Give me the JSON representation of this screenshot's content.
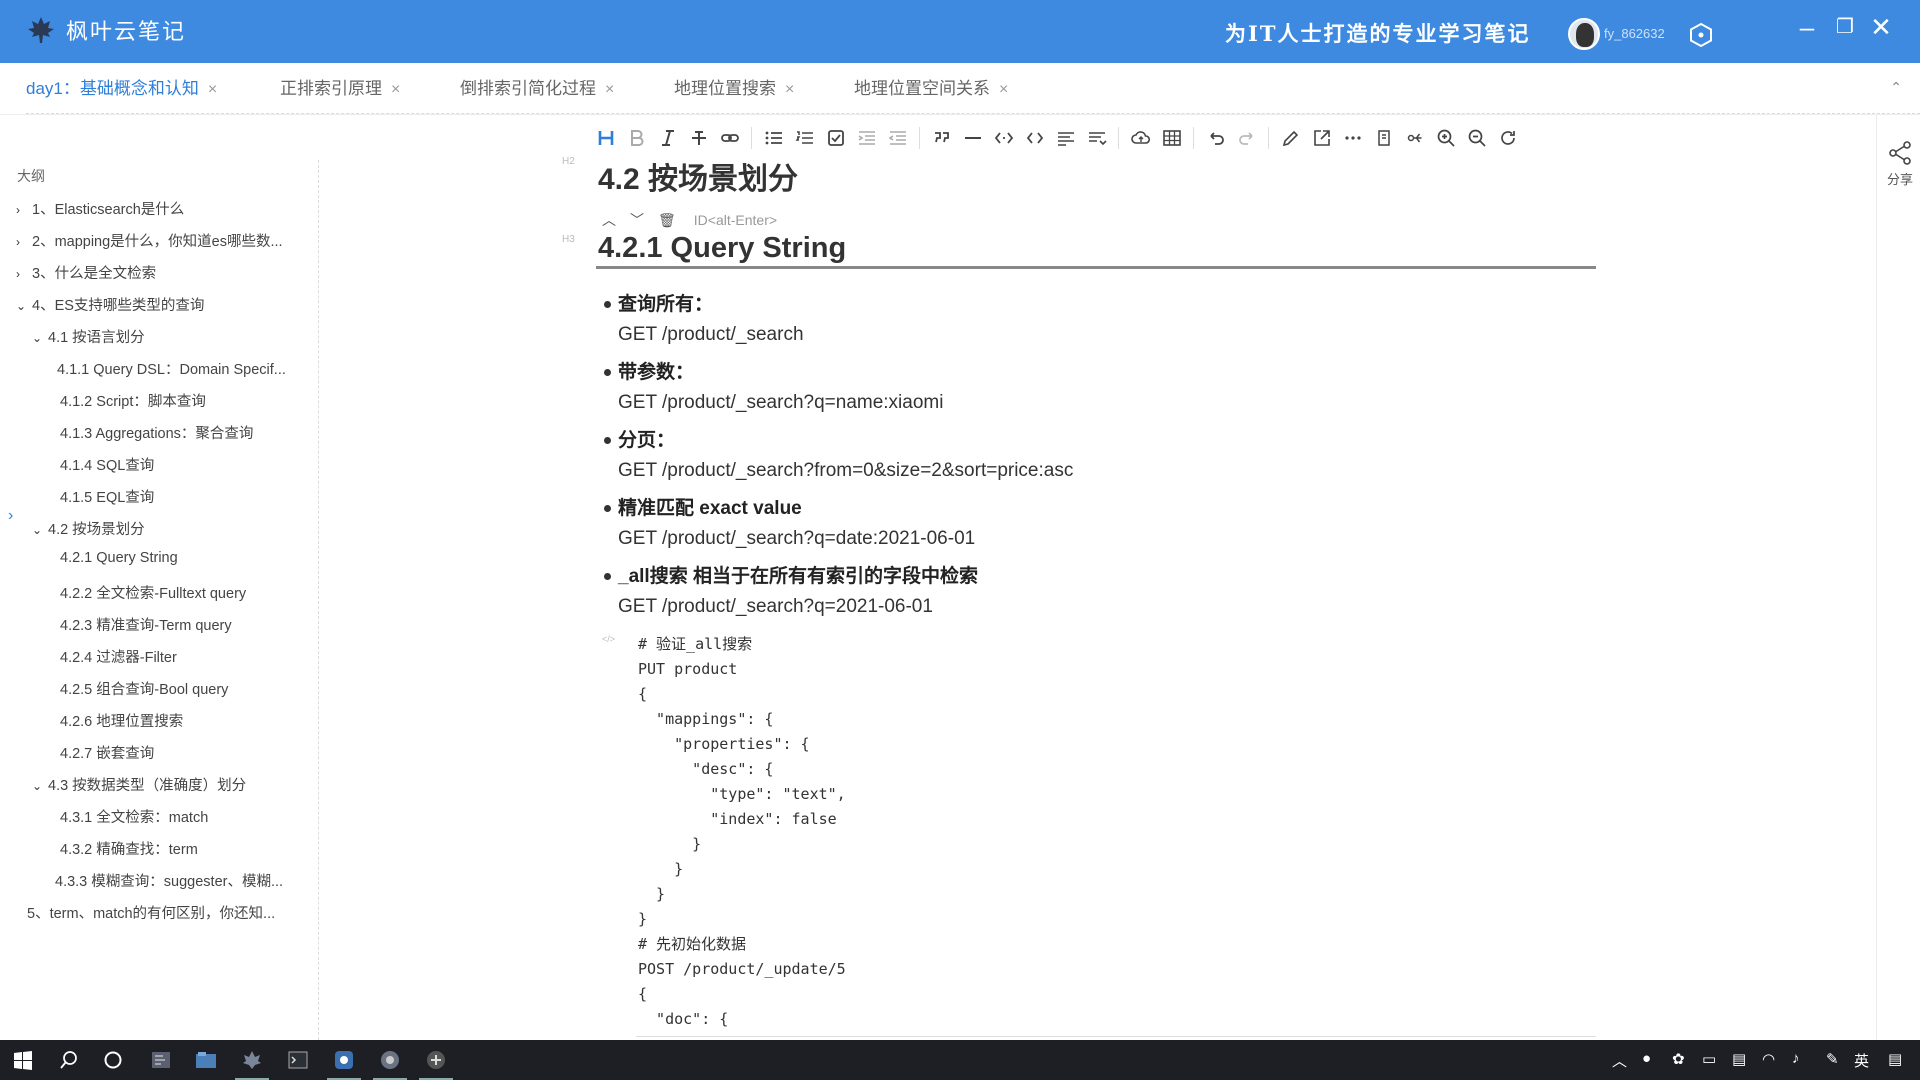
{
  "app": {
    "logo_text": "枫叶云笔记",
    "slogan": "为IT人士打造的专业学习笔记",
    "username": "fy_862632"
  },
  "tabs": [
    {
      "label": "day1：基础概念和认知",
      "active": true
    },
    {
      "label": "正排索引原理",
      "active": false
    },
    {
      "label": "倒排索引简化过程",
      "active": false
    },
    {
      "label": "地理位置搜索",
      "active": false
    },
    {
      "label": "地理位置空间关系",
      "active": false
    }
  ],
  "tab_close": "×",
  "toolbar_icons": [
    "heading-icon",
    "bold-icon",
    "italic-icon",
    "strikethrough-icon",
    "link-icon",
    "bullet-list-icon",
    "ordered-list-icon",
    "checkbox-icon",
    "indent-icon",
    "outdent-icon",
    "quote-icon",
    "hr-icon",
    "code-inline-icon",
    "code-block-icon",
    "align-icon",
    "wrap-icon",
    "cloud-icon",
    "table-icon",
    "undo-icon",
    "redo-icon",
    "edit-icon",
    "export-icon",
    "more-icon",
    "preview-icon",
    "mindmap-icon",
    "zoom-in-icon",
    "zoom-out-icon",
    "refresh-icon"
  ],
  "outline": {
    "title": "大纲",
    "items": [
      {
        "label": "1、Elasticsearch是什么",
        "arrow": "›",
        "level": 0
      },
      {
        "label": "2、mapping是什么，你知道es哪些数...",
        "arrow": "›",
        "level": 0
      },
      {
        "label": "3、什么是全文检索",
        "arrow": "›",
        "level": 0
      },
      {
        "label": "4、ES支持哪些类型的查询",
        "arrow": "⌄",
        "level": 0
      },
      {
        "label": "4.1 按语言划分",
        "arrow": "⌄",
        "level": 1
      },
      {
        "label": "4.1.1 Query DSL：Domain Specif...",
        "arrow": "",
        "level": 2
      },
      {
        "label": "4.1.2 Script：脚本查询",
        "arrow": "",
        "level": 2
      },
      {
        "label": "4.1.3 Aggregations：聚合查询",
        "arrow": "",
        "level": 2
      },
      {
        "label": "4.1.4 SQL查询",
        "arrow": "",
        "level": 2
      },
      {
        "label": "4.1.5 EQL查询",
        "arrow": "",
        "level": 2
      },
      {
        "label": "4.2 按场景划分",
        "arrow": "⌄",
        "level": 1
      },
      {
        "label": "4.2.1 Query String",
        "arrow": "",
        "level": 2
      },
      {
        "label": "4.2.2 全文检索-Fulltext query",
        "arrow": "",
        "level": 2
      },
      {
        "label": "4.2.3 精准查询-Term query",
        "arrow": "",
        "level": 2
      },
      {
        "label": "4.2.4 过滤器-Filter",
        "arrow": "",
        "level": 2
      },
      {
        "label": "4.2.5 组合查询-Bool query",
        "arrow": "",
        "level": 2
      },
      {
        "label": "4.2.6 地理位置搜索",
        "arrow": "",
        "level": 2
      },
      {
        "label": "4.2.7 嵌套查询",
        "arrow": "",
        "level": 2
      },
      {
        "label": "4.3 按数据类型（准确度）划分",
        "arrow": "⌄",
        "level": 1
      },
      {
        "label": "4.3.1 全文检索：match",
        "arrow": "",
        "level": 2
      },
      {
        "label": "4.3.2 精确查找：term",
        "arrow": "",
        "level": 2
      },
      {
        "label": "4.3.3 模糊查询：suggester、模糊...",
        "arrow": "",
        "level": 2
      },
      {
        "label": "5、term、match的有何区别，你还知...",
        "arrow": "",
        "level": 0
      }
    ]
  },
  "document": {
    "h2": "4.2 按场景划分",
    "h2_mark": "H2",
    "h3": "4.2.1 Query String",
    "h3_mark": "H3",
    "id_hint": "ID<alt-Enter>",
    "bullets": [
      {
        "title": "查询所有：",
        "value": "GET /product/_search"
      },
      {
        "title": "带参数：",
        "value": "GET /product/_search?q=name:xiaomi"
      },
      {
        "title": "分页：",
        "value": "GET /product/_search?from=0&size=2&sort=price:asc"
      },
      {
        "title": "精准匹配 exact value",
        "value": "GET /product/_search?q=date:2021-06-01"
      },
      {
        "title": "_all搜索 相当于在所有有索引的字段中检索",
        "value": "GET /product/_search?q=2021-06-01"
      }
    ],
    "code_mark": "</>",
    "code": "# 验证_all搜索\nPUT product\n{\n  \"mappings\": {\n    \"properties\": {\n      \"desc\": {\n        \"type\": \"text\",\n        \"index\": false\n      }\n    }\n  }\n}\n# 先初始化数据\nPOST /product/_update/5\n{\n  \"doc\": {"
  },
  "share_label": "分享",
  "taskbar": {
    "ime_label": "英"
  },
  "colors": {
    "titlebar": "#3d8ae0",
    "accent": "#2f7fd8",
    "taskbar": "#1d1f24"
  }
}
